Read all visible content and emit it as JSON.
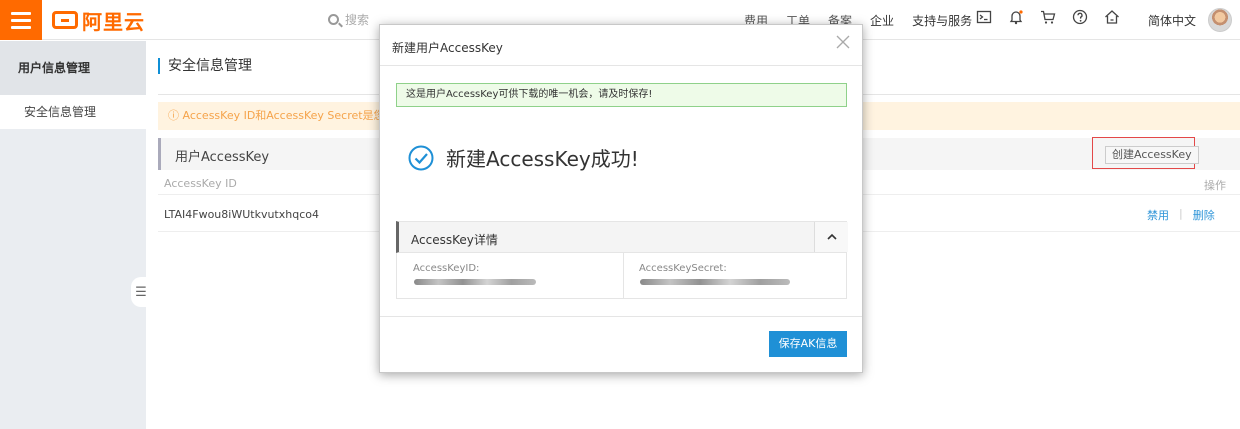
{
  "topbar": {
    "logo_text": "阿里云",
    "search_placeholder": "搜索",
    "nav": [
      "费用",
      "工单",
      "备案",
      "企业",
      "支持与服务"
    ],
    "icons": [
      "terminal-icon",
      "bell-icon",
      "cart-icon",
      "help-icon",
      "home-icon"
    ],
    "language": "简体中文"
  },
  "sidebar": {
    "header": "用户信息管理",
    "items": [
      {
        "label": "安全信息管理"
      }
    ]
  },
  "main": {
    "page_title": "安全信息管理",
    "notice": "ⓘ AccessKey ID和AccessKey Secret是您访问阿里",
    "panel_title": "用户AccessKey",
    "create_button": "创建AccessKey",
    "table": {
      "col_id": "AccessKey ID",
      "col_op": "操作",
      "rows": [
        {
          "id": "LTAI4Fwou8iWUtkvutxhqco4",
          "disable": "禁用",
          "delete": "删除"
        }
      ]
    }
  },
  "modal": {
    "title": "新建用户AccessKey",
    "tip": "这是用户AccessKey可供下载的唯一机会，请及时保存!",
    "success": "新建AccessKey成功!",
    "detail_title": "AccessKey详情",
    "id_label": "AccessKeyID:",
    "secret_label": "AccessKeySecret:",
    "save_button": "保存AK信息"
  },
  "colors": {
    "accent": "#ff6a00",
    "primary": "#1f90d6",
    "success": "#1f90d6",
    "highlight_border": "#e34848"
  }
}
